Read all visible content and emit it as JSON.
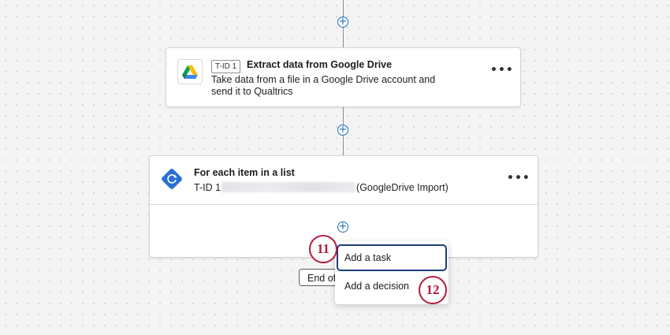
{
  "task_card": {
    "icon": "google-drive-icon",
    "tid": "T-ID 1",
    "title": "Extract data from Google Drive",
    "description": "Take data from a file in a Google Drive account and send it to Qualtrics",
    "more": "•••"
  },
  "loop_card": {
    "icon": "loop-icon",
    "title": "For each item in a list",
    "desc_prefix": "T-ID 1",
    "desc_suffix": "(GoogleDrive Import)",
    "more": "•••"
  },
  "add_buttons": {
    "symbol": "+"
  },
  "end_button": {
    "label": "End of"
  },
  "add_menu": {
    "items": [
      {
        "label": "Add a task"
      },
      {
        "label": "Add a decision"
      }
    ]
  },
  "callouts": [
    "11",
    "12"
  ],
  "colors": {
    "accent_blue": "#1f6dbb",
    "loop_blue": "#2a6fd6",
    "callout_red": "#b31b3b",
    "focus_border": "#1b3d78"
  }
}
